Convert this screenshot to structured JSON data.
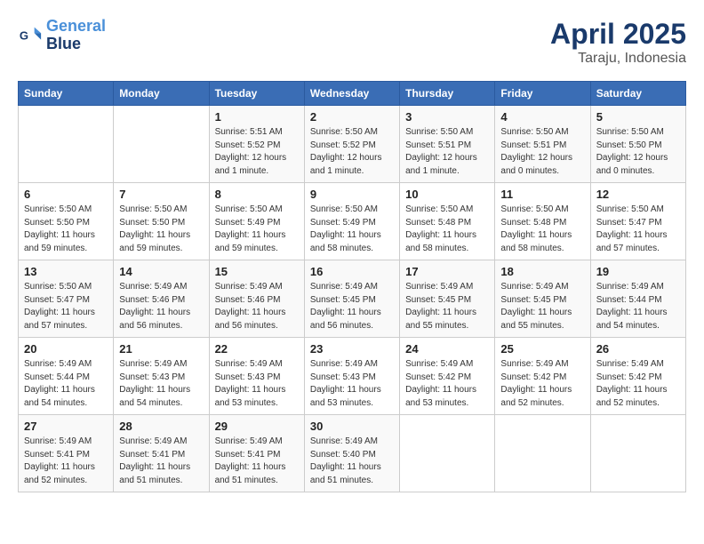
{
  "logo": {
    "line1": "General",
    "line2": "Blue"
  },
  "title": "April 2025",
  "subtitle": "Taraju, Indonesia",
  "days_of_week": [
    "Sunday",
    "Monday",
    "Tuesday",
    "Wednesday",
    "Thursday",
    "Friday",
    "Saturday"
  ],
  "weeks": [
    [
      {
        "day": "",
        "detail": ""
      },
      {
        "day": "",
        "detail": ""
      },
      {
        "day": "1",
        "detail": "Sunrise: 5:51 AM\nSunset: 5:52 PM\nDaylight: 12 hours and 1 minute."
      },
      {
        "day": "2",
        "detail": "Sunrise: 5:50 AM\nSunset: 5:52 PM\nDaylight: 12 hours and 1 minute."
      },
      {
        "day": "3",
        "detail": "Sunrise: 5:50 AM\nSunset: 5:51 PM\nDaylight: 12 hours and 1 minute."
      },
      {
        "day": "4",
        "detail": "Sunrise: 5:50 AM\nSunset: 5:51 PM\nDaylight: 12 hours and 0 minutes."
      },
      {
        "day": "5",
        "detail": "Sunrise: 5:50 AM\nSunset: 5:50 PM\nDaylight: 12 hours and 0 minutes."
      }
    ],
    [
      {
        "day": "6",
        "detail": "Sunrise: 5:50 AM\nSunset: 5:50 PM\nDaylight: 11 hours and 59 minutes."
      },
      {
        "day": "7",
        "detail": "Sunrise: 5:50 AM\nSunset: 5:50 PM\nDaylight: 11 hours and 59 minutes."
      },
      {
        "day": "8",
        "detail": "Sunrise: 5:50 AM\nSunset: 5:49 PM\nDaylight: 11 hours and 59 minutes."
      },
      {
        "day": "9",
        "detail": "Sunrise: 5:50 AM\nSunset: 5:49 PM\nDaylight: 11 hours and 58 minutes."
      },
      {
        "day": "10",
        "detail": "Sunrise: 5:50 AM\nSunset: 5:48 PM\nDaylight: 11 hours and 58 minutes."
      },
      {
        "day": "11",
        "detail": "Sunrise: 5:50 AM\nSunset: 5:48 PM\nDaylight: 11 hours and 58 minutes."
      },
      {
        "day": "12",
        "detail": "Sunrise: 5:50 AM\nSunset: 5:47 PM\nDaylight: 11 hours and 57 minutes."
      }
    ],
    [
      {
        "day": "13",
        "detail": "Sunrise: 5:50 AM\nSunset: 5:47 PM\nDaylight: 11 hours and 57 minutes."
      },
      {
        "day": "14",
        "detail": "Sunrise: 5:49 AM\nSunset: 5:46 PM\nDaylight: 11 hours and 56 minutes."
      },
      {
        "day": "15",
        "detail": "Sunrise: 5:49 AM\nSunset: 5:46 PM\nDaylight: 11 hours and 56 minutes."
      },
      {
        "day": "16",
        "detail": "Sunrise: 5:49 AM\nSunset: 5:45 PM\nDaylight: 11 hours and 56 minutes."
      },
      {
        "day": "17",
        "detail": "Sunrise: 5:49 AM\nSunset: 5:45 PM\nDaylight: 11 hours and 55 minutes."
      },
      {
        "day": "18",
        "detail": "Sunrise: 5:49 AM\nSunset: 5:45 PM\nDaylight: 11 hours and 55 minutes."
      },
      {
        "day": "19",
        "detail": "Sunrise: 5:49 AM\nSunset: 5:44 PM\nDaylight: 11 hours and 54 minutes."
      }
    ],
    [
      {
        "day": "20",
        "detail": "Sunrise: 5:49 AM\nSunset: 5:44 PM\nDaylight: 11 hours and 54 minutes."
      },
      {
        "day": "21",
        "detail": "Sunrise: 5:49 AM\nSunset: 5:43 PM\nDaylight: 11 hours and 54 minutes."
      },
      {
        "day": "22",
        "detail": "Sunrise: 5:49 AM\nSunset: 5:43 PM\nDaylight: 11 hours and 53 minutes."
      },
      {
        "day": "23",
        "detail": "Sunrise: 5:49 AM\nSunset: 5:43 PM\nDaylight: 11 hours and 53 minutes."
      },
      {
        "day": "24",
        "detail": "Sunrise: 5:49 AM\nSunset: 5:42 PM\nDaylight: 11 hours and 53 minutes."
      },
      {
        "day": "25",
        "detail": "Sunrise: 5:49 AM\nSunset: 5:42 PM\nDaylight: 11 hours and 52 minutes."
      },
      {
        "day": "26",
        "detail": "Sunrise: 5:49 AM\nSunset: 5:42 PM\nDaylight: 11 hours and 52 minutes."
      }
    ],
    [
      {
        "day": "27",
        "detail": "Sunrise: 5:49 AM\nSunset: 5:41 PM\nDaylight: 11 hours and 52 minutes."
      },
      {
        "day": "28",
        "detail": "Sunrise: 5:49 AM\nSunset: 5:41 PM\nDaylight: 11 hours and 51 minutes."
      },
      {
        "day": "29",
        "detail": "Sunrise: 5:49 AM\nSunset: 5:41 PM\nDaylight: 11 hours and 51 minutes."
      },
      {
        "day": "30",
        "detail": "Sunrise: 5:49 AM\nSunset: 5:40 PM\nDaylight: 11 hours and 51 minutes."
      },
      {
        "day": "",
        "detail": ""
      },
      {
        "day": "",
        "detail": ""
      },
      {
        "day": "",
        "detail": ""
      }
    ]
  ]
}
